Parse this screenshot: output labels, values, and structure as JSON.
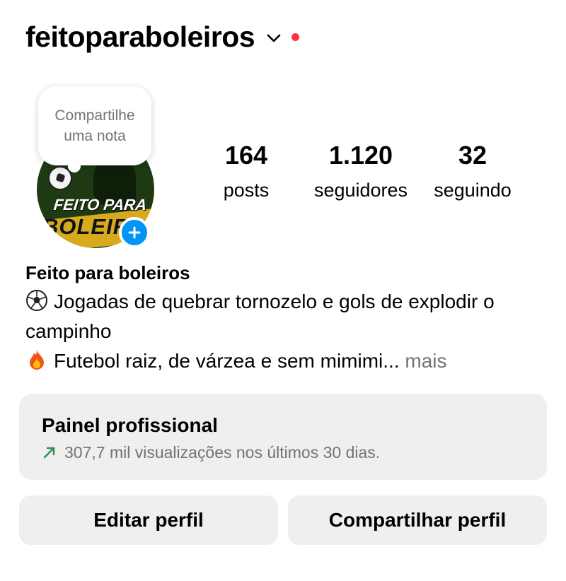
{
  "header": {
    "username": "feitoparaboleiros",
    "account_switcher_icon": "chevron-down-icon",
    "notification_dot_color": "#ff3040"
  },
  "profile": {
    "note_placeholder": "Compartilhe uma nota",
    "avatar_text_top": "FEITO PARA",
    "avatar_text_bottom": "BOLEIROS",
    "add_story_icon": "plus-icon",
    "add_story_color": "#0095f6"
  },
  "stats": {
    "posts": {
      "value": "164",
      "label": "posts"
    },
    "followers": {
      "value": "1.120",
      "label": "seguidores"
    },
    "following": {
      "value": "32",
      "label": "seguindo"
    }
  },
  "bio": {
    "name": "Feito para boleiros",
    "line1_icon": "soccer-ball-icon",
    "line1": "Jogadas de quebrar tornozelo e gols de explodir o campinho",
    "line2_icon": "fire-icon",
    "line2": "Futebol raiz, de várzea e sem mimimi...",
    "more": "mais"
  },
  "dashboard": {
    "title": "Painel profissional",
    "trend_icon": "trend-up-arrow-icon",
    "trend_color": "#2e8b57",
    "subtitle": "307,7 mil visualizações nos últimos 30 dias."
  },
  "actions": {
    "edit_profile": "Editar perfil",
    "share_profile": "Compartilhar perfil"
  }
}
